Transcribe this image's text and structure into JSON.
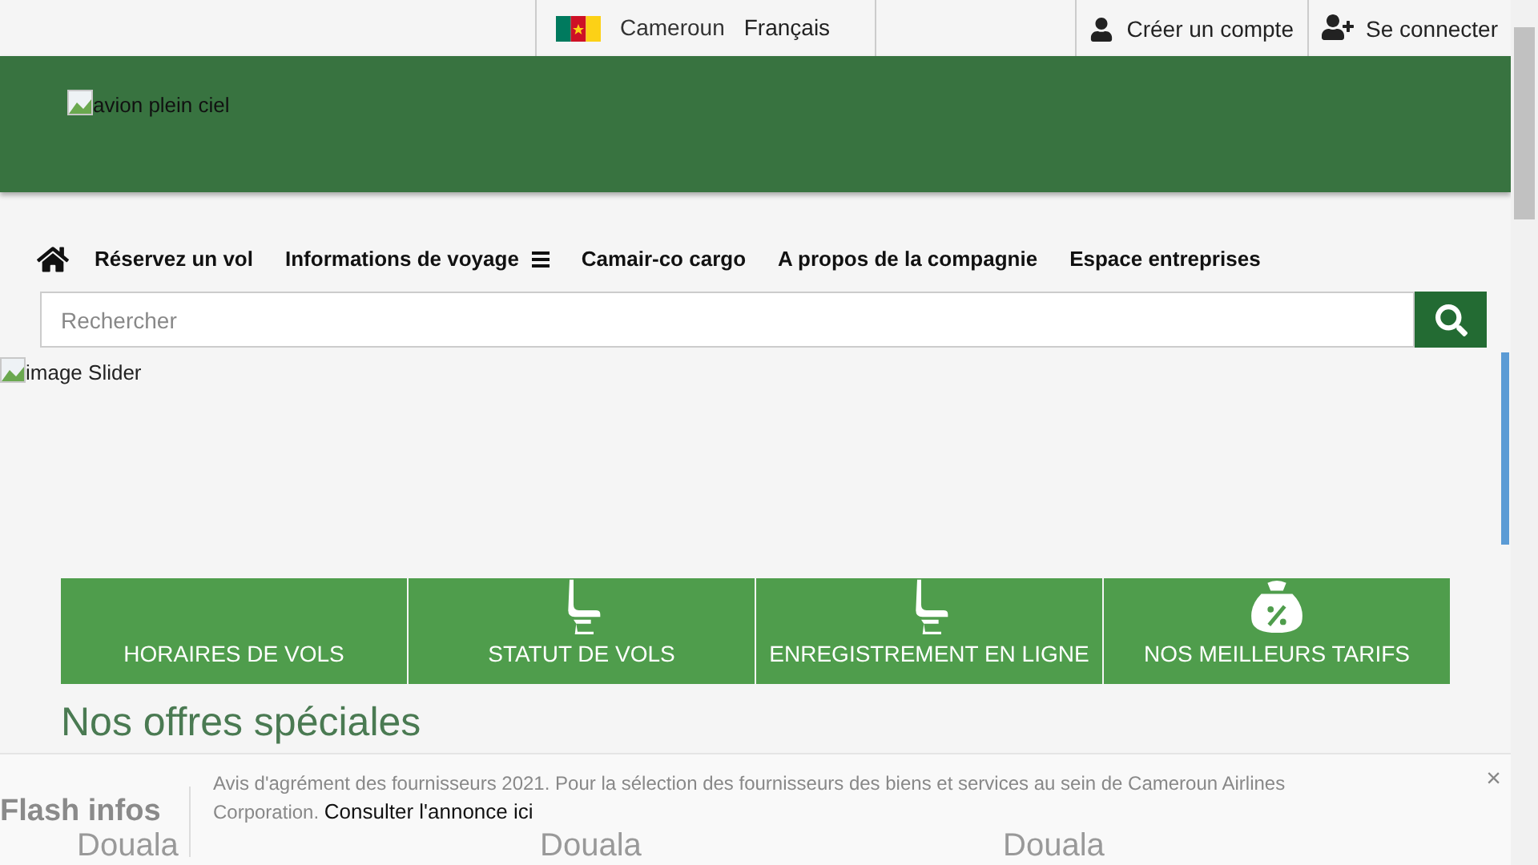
{
  "topbar": {
    "country": "Cameroun",
    "language": "Français",
    "account_links": [
      {
        "kind": "user",
        "label": "Créer un compte"
      },
      {
        "kind": "user-plus",
        "label": "Se connecter"
      }
    ]
  },
  "header": {
    "logo_alt": "avion plein ciel"
  },
  "nav": {
    "items": [
      {
        "label": "Réservez un vol",
        "menu": false
      },
      {
        "label": "Informations de voyage",
        "menu": true
      },
      {
        "label": "Camair-co cargo",
        "menu": false
      },
      {
        "label": "A propos de la compagnie",
        "menu": false
      },
      {
        "label": "Espace entreprises",
        "menu": false
      }
    ]
  },
  "search": {
    "placeholder": "Rechercher"
  },
  "slider": {
    "alt": "image Slider"
  },
  "features": [
    {
      "kind": "none",
      "label": "HORAIRES DE VOLS"
    },
    {
      "kind": "seat",
      "label": "STATUT DE VOLS"
    },
    {
      "kind": "seat",
      "label": "ENREGISTREMENT EN LIGNE"
    },
    {
      "kind": "purse",
      "label": "NOS MEILLEURS TARIFS"
    }
  ],
  "offers": {
    "title": "Nos offres spéciales",
    "cities": [
      "Douala",
      "Douala",
      "Douala"
    ]
  },
  "flash": {
    "title": "Flash infos",
    "text": "Avis d'agrément des fournisseurs 2021. Pour la sélection des fournisseurs des biens et services au sein de Cameroun Airlines Corporation.",
    "link": "Consulter l'annonce ici",
    "close": "×"
  }
}
